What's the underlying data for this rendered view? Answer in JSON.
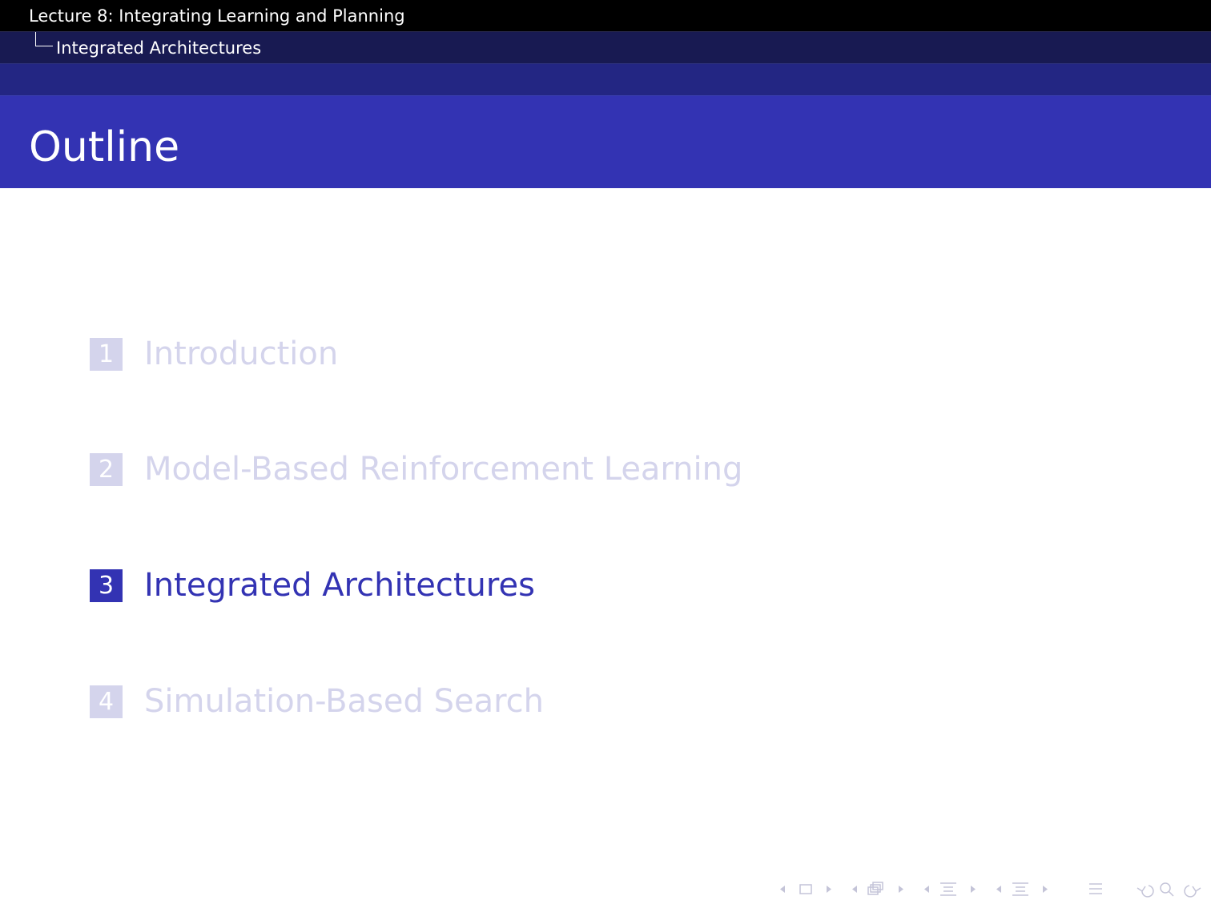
{
  "header": {
    "lecture": "Lecture 8: Integrating Learning and Planning",
    "section": "Integrated Architectures"
  },
  "slide": {
    "title": "Outline"
  },
  "toc": [
    {
      "number": "1",
      "label": "Introduction",
      "active": false
    },
    {
      "number": "2",
      "label": "Model-Based Reinforcement Learning",
      "active": false
    },
    {
      "number": "3",
      "label": "Integrated Architectures",
      "active": true
    },
    {
      "number": "4",
      "label": "Simulation-Based Search",
      "active": false
    }
  ],
  "nav_icons": [
    "prev-arrow-icon",
    "frame-icon",
    "next-arrow-icon",
    "prev-arrow-icon",
    "subsection-icon",
    "next-arrow-icon",
    "prev-arrow-icon",
    "section-icon",
    "next-arrow-icon",
    "prev-arrow-icon",
    "section-icon",
    "next-arrow-icon",
    "align-icon",
    "undo-icon",
    "search-icon",
    "redo-icon"
  ],
  "colors": {
    "accent": "#3333b3",
    "dim": "#d4d4ec",
    "header_black": "#000000",
    "header_navy": "#181a52"
  }
}
